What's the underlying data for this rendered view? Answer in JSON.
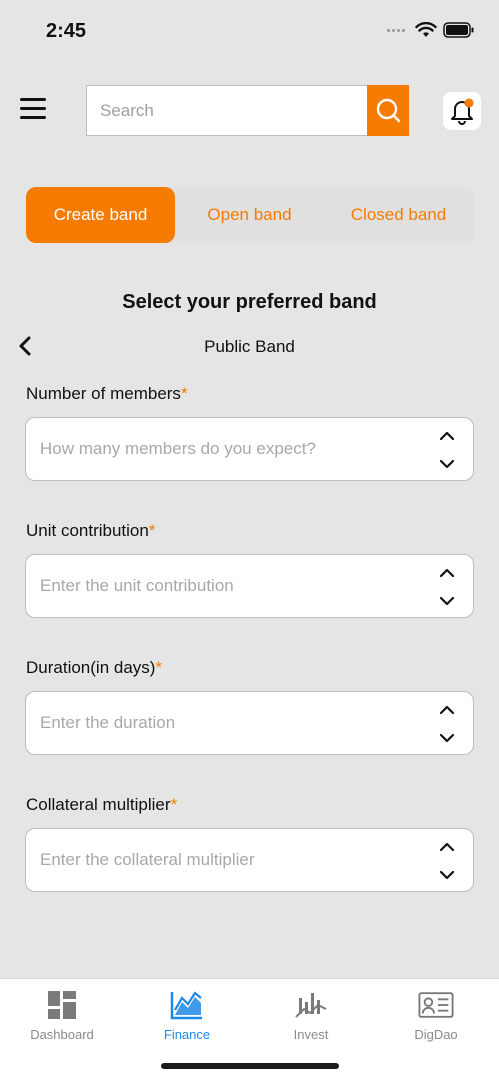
{
  "status_bar": {
    "time": "2:45"
  },
  "header": {
    "search_placeholder": "Search",
    "accent_color": "#f57c00"
  },
  "tabs": [
    {
      "label": "Create band",
      "active": true
    },
    {
      "label": "Open band",
      "active": false
    },
    {
      "label": "Closed band",
      "active": false
    }
  ],
  "section_title": "Select your preferred band",
  "band_type": "Public Band",
  "fields": [
    {
      "label": "Number of members",
      "required_mark": "*",
      "placeholder": "How many members do you expect?"
    },
    {
      "label": "Unit contribution",
      "required_mark": "*",
      "placeholder": "Enter the unit contribution"
    },
    {
      "label": "Duration(in days)",
      "required_mark": "*",
      "placeholder": "Enter the duration"
    },
    {
      "label": "Collateral multiplier",
      "required_mark": "*",
      "placeholder": "Enter the collateral multiplier"
    }
  ],
  "bottom_nav": [
    {
      "label": "Dashboard",
      "icon": "dashboard-icon",
      "active": false
    },
    {
      "label": "Finance",
      "icon": "finance-chart-icon",
      "active": true
    },
    {
      "label": "Invest",
      "icon": "invest-chart-icon",
      "active": false
    },
    {
      "label": "DigDao",
      "icon": "id-card-icon",
      "active": false
    }
  ]
}
